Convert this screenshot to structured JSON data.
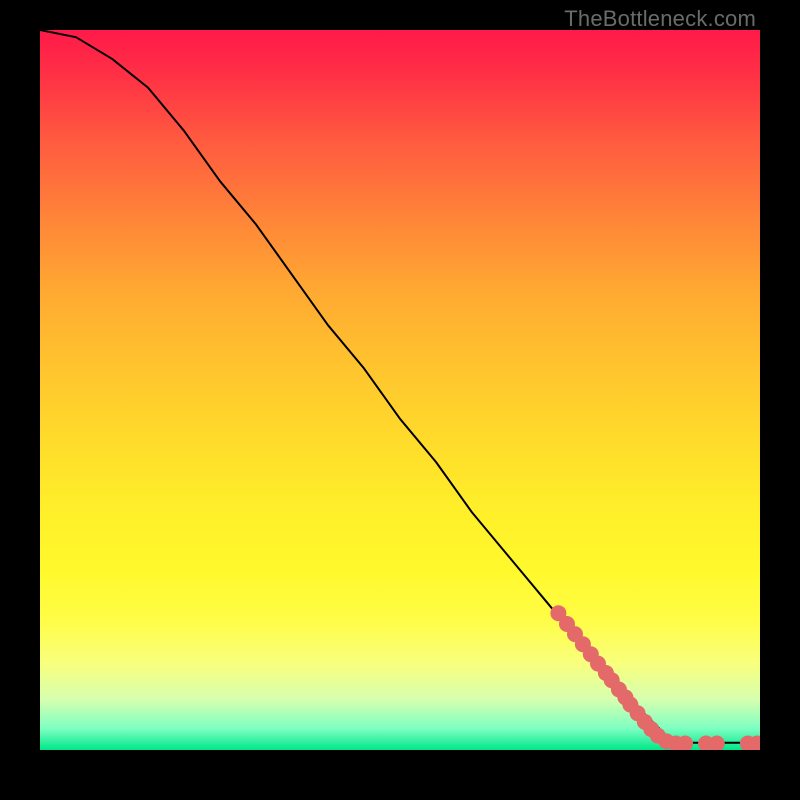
{
  "watermark": "TheBottleneck.com",
  "colors": {
    "marker_fill": "#e46a6a",
    "curve_stroke": "#000000",
    "gradient_top": "#ff1a49",
    "gradient_bottom": "#00e789",
    "background": "#000000"
  },
  "chart_data": {
    "type": "line",
    "title": "",
    "xlabel": "",
    "ylabel": "",
    "xlim": [
      0,
      100
    ],
    "ylim": [
      0,
      100
    ],
    "grid": false,
    "series": [
      {
        "name": "curve",
        "x": [
          0,
          5,
          10,
          15,
          20,
          25,
          30,
          35,
          40,
          45,
          50,
          55,
          60,
          65,
          70,
          75,
          80,
          82,
          85,
          87,
          90,
          93,
          96,
          100
        ],
        "y": [
          100,
          99,
          96,
          92,
          86,
          79,
          73,
          66,
          59,
          53,
          46,
          40,
          33,
          27,
          21,
          15,
          9,
          7,
          4,
          2,
          1,
          1,
          1,
          1
        ]
      }
    ],
    "markers": [
      {
        "x": 72.0,
        "y": 19.0
      },
      {
        "x": 73.2,
        "y": 17.5
      },
      {
        "x": 74.3,
        "y": 16.1
      },
      {
        "x": 75.4,
        "y": 14.7
      },
      {
        "x": 76.5,
        "y": 13.3
      },
      {
        "x": 77.5,
        "y": 12.0
      },
      {
        "x": 78.6,
        "y": 10.7
      },
      {
        "x": 79.4,
        "y": 9.7
      },
      {
        "x": 80.4,
        "y": 8.4
      },
      {
        "x": 81.3,
        "y": 7.3
      },
      {
        "x": 82.0,
        "y": 6.3
      },
      {
        "x": 83.0,
        "y": 5.1
      },
      {
        "x": 84.0,
        "y": 3.9
      },
      {
        "x": 84.9,
        "y": 2.9
      },
      {
        "x": 85.8,
        "y": 2.0
      },
      {
        "x": 87.0,
        "y": 1.2
      },
      {
        "x": 88.3,
        "y": 0.9
      },
      {
        "x": 89.6,
        "y": 0.9
      },
      {
        "x": 92.5,
        "y": 0.9
      },
      {
        "x": 94.0,
        "y": 0.9
      },
      {
        "x": 98.3,
        "y": 0.9
      },
      {
        "x": 99.6,
        "y": 0.9
      }
    ]
  }
}
